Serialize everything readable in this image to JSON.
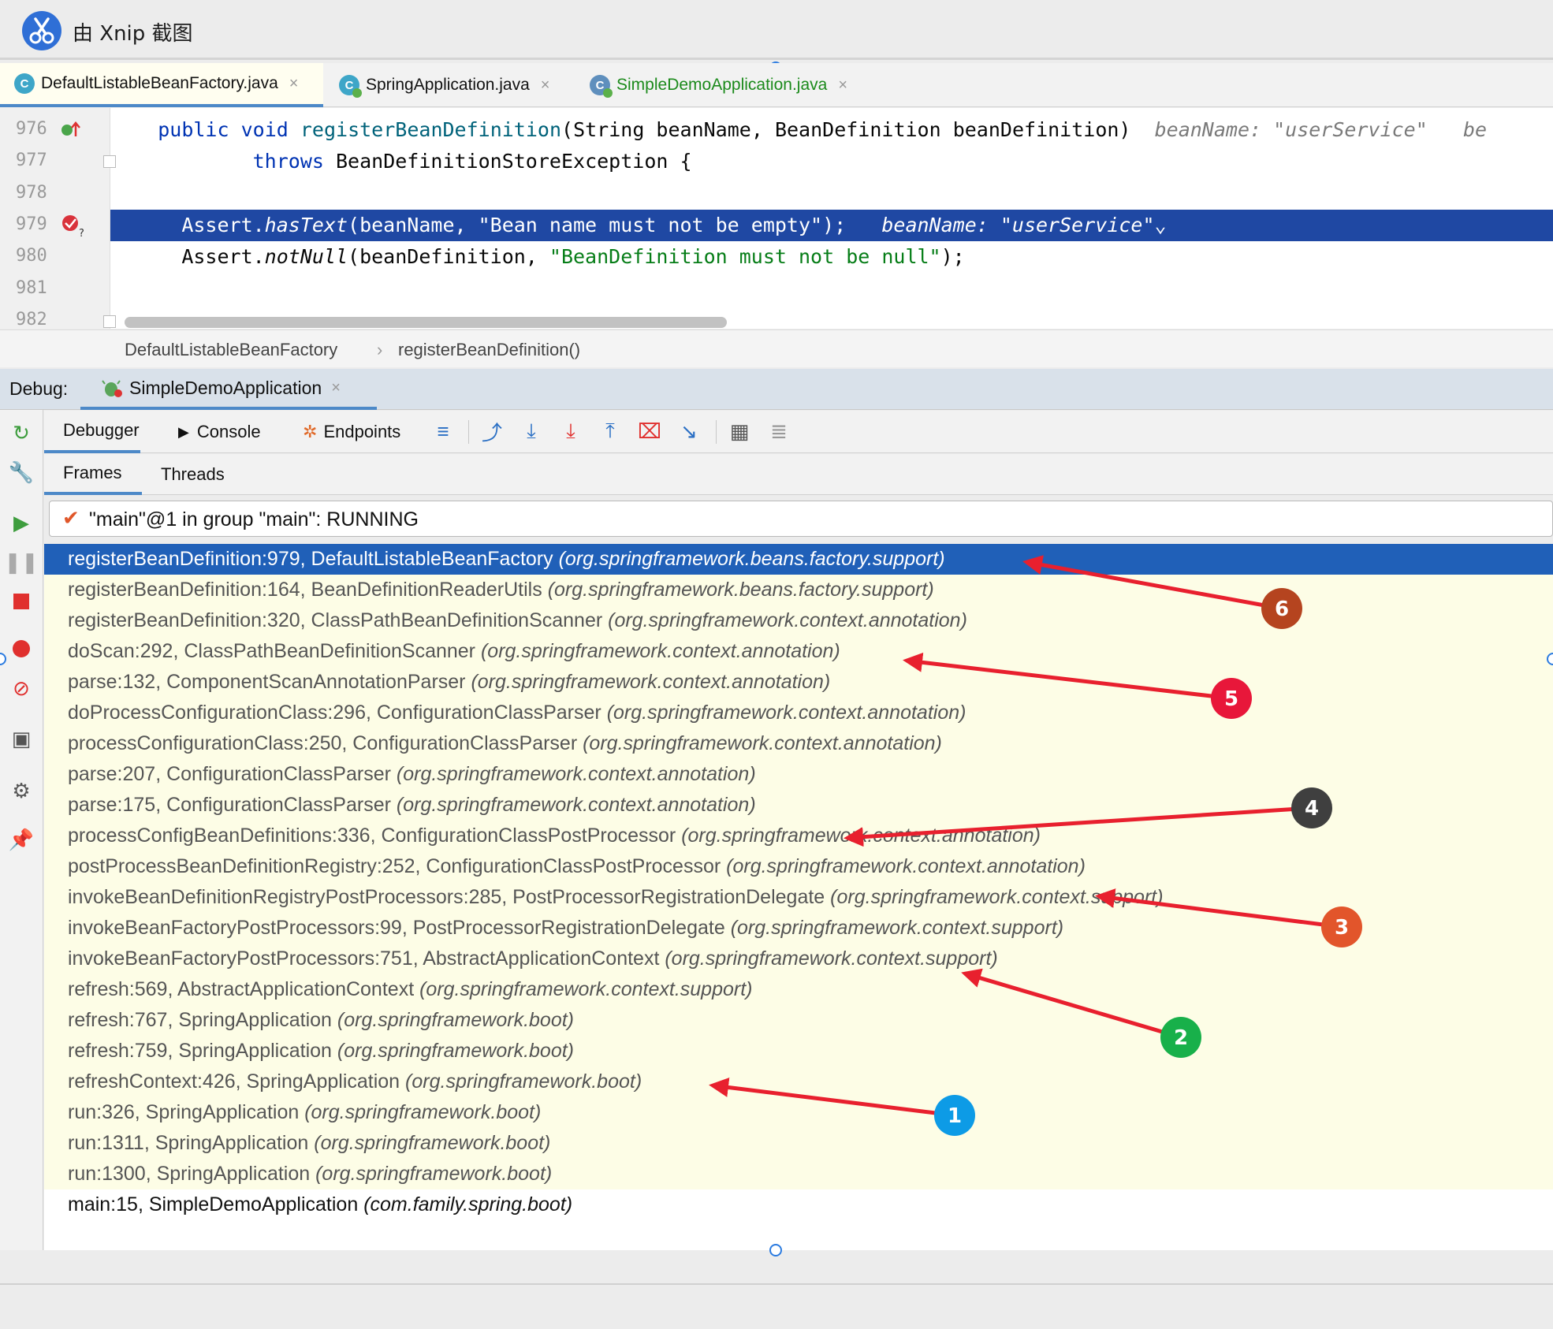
{
  "window": {
    "title": "由 Xnip 截图"
  },
  "editor_tabs": [
    {
      "label": "DefaultListableBeanFactory.java",
      "icon": "class-icon",
      "active": true
    },
    {
      "label": "SpringApplication.java",
      "icon": "spring-class-icon",
      "active": false
    },
    {
      "label": "SimpleDemoApplication.java",
      "icon": "spring-boot-class-icon",
      "active": false
    }
  ],
  "tab_close_glyph": "×",
  "code": {
    "line_numbers": [
      "976",
      "977",
      "978",
      "979",
      "980",
      "981",
      "982"
    ],
    "line976": {
      "kw1": "public",
      "kw2": "void",
      "fn": "registerBeanDefinition",
      "rest": "(String beanName, BeanDefinition beanDefinition)",
      "inlay": "beanName: \"userService\"",
      "inlay2": "be"
    },
    "line977": {
      "kw": "throws",
      "rest": " BeanDefinitionStoreException {"
    },
    "line979": {
      "cls": "Assert.",
      "method": "hasText",
      "args": "(beanName, \"Bean name must not be empty\");",
      "inlay": "beanName: \"userService\"",
      "chevron": "⌄"
    },
    "line980": {
      "cls": "Assert.",
      "method": "notNull",
      "pre": "(beanDefinition, ",
      "str": "\"BeanDefinition must not be null\"",
      "post": ");"
    }
  },
  "breadcrumb": {
    "class": "DefaultListableBeanFactory",
    "sep": "›",
    "method": "registerBeanDefinition()"
  },
  "debug": {
    "label": "Debug:",
    "session": "SimpleDemoApplication",
    "toolbar_tabs": [
      "Debugger",
      "Console",
      "Endpoints"
    ],
    "subtabs": [
      "Frames",
      "Threads"
    ],
    "thread": "\"main\"@1 in group \"main\": RUNNING"
  },
  "frames": [
    {
      "method": "registerBeanDefinition:979, DefaultListableBeanFactory",
      "pkg": "(org.springframework.beans.factory.support)",
      "kind": "sel"
    },
    {
      "method": "registerBeanDefinition:164, BeanDefinitionReaderUtils",
      "pkg": "(org.springframework.beans.factory.support)",
      "kind": "lib"
    },
    {
      "method": "registerBeanDefinition:320, ClassPathBeanDefinitionScanner",
      "pkg": "(org.springframework.context.annotation)",
      "kind": "lib"
    },
    {
      "method": "doScan:292, ClassPathBeanDefinitionScanner",
      "pkg": "(org.springframework.context.annotation)",
      "kind": "lib"
    },
    {
      "method": "parse:132, ComponentScanAnnotationParser",
      "pkg": "(org.springframework.context.annotation)",
      "kind": "lib"
    },
    {
      "method": "doProcessConfigurationClass:296, ConfigurationClassParser",
      "pkg": "(org.springframework.context.annotation)",
      "kind": "lib"
    },
    {
      "method": "processConfigurationClass:250, ConfigurationClassParser",
      "pkg": "(org.springframework.context.annotation)",
      "kind": "lib"
    },
    {
      "method": "parse:207, ConfigurationClassParser",
      "pkg": "(org.springframework.context.annotation)",
      "kind": "lib"
    },
    {
      "method": "parse:175, ConfigurationClassParser",
      "pkg": "(org.springframework.context.annotation)",
      "kind": "lib"
    },
    {
      "method": "processConfigBeanDefinitions:336, ConfigurationClassPostProcessor",
      "pkg": "(org.springframework.context.annotation)",
      "kind": "lib"
    },
    {
      "method": "postProcessBeanDefinitionRegistry:252, ConfigurationClassPostProcessor",
      "pkg": "(org.springframework.context.annotation)",
      "kind": "lib"
    },
    {
      "method": "invokeBeanDefinitionRegistryPostProcessors:285, PostProcessorRegistrationDelegate",
      "pkg": "(org.springframework.context.support)",
      "kind": "lib"
    },
    {
      "method": "invokeBeanFactoryPostProcessors:99, PostProcessorRegistrationDelegate",
      "pkg": "(org.springframework.context.support)",
      "kind": "lib"
    },
    {
      "method": "invokeBeanFactoryPostProcessors:751, AbstractApplicationContext",
      "pkg": "(org.springframework.context.support)",
      "kind": "lib"
    },
    {
      "method": "refresh:569, AbstractApplicationContext",
      "pkg": "(org.springframework.context.support)",
      "kind": "lib"
    },
    {
      "method": "refresh:767, SpringApplication",
      "pkg": "(org.springframework.boot)",
      "kind": "lib"
    },
    {
      "method": "refresh:759, SpringApplication",
      "pkg": "(org.springframework.boot)",
      "kind": "lib"
    },
    {
      "method": "refreshContext:426, SpringApplication",
      "pkg": "(org.springframework.boot)",
      "kind": "lib"
    },
    {
      "method": "run:326, SpringApplication",
      "pkg": "(org.springframework.boot)",
      "kind": "lib"
    },
    {
      "method": "run:1311, SpringApplication",
      "pkg": "(org.springframework.boot)",
      "kind": "lib"
    },
    {
      "method": "run:1300, SpringApplication",
      "pkg": "(org.springframework.boot)",
      "kind": "lib"
    },
    {
      "method": "main:15, SimpleDemoApplication",
      "pkg": "(com.family.spring.boot)",
      "kind": "user"
    }
  ],
  "annotations": [
    {
      "label": "6",
      "color": "#b5441f"
    },
    {
      "label": "5",
      "color": "#e8173a"
    },
    {
      "label": "4",
      "color": "#3f3f3f"
    },
    {
      "label": "3",
      "color": "#e2552b"
    },
    {
      "label": "2",
      "color": "#18b04a"
    },
    {
      "label": "1",
      "color": "#0d9be6"
    }
  ],
  "colors": {
    "accent": "#4d89c8",
    "selection": "#2060b8",
    "code_highlight": "#1f48a3",
    "library_frame_bg": "#fdfde6",
    "arrow": "#e8202e"
  }
}
